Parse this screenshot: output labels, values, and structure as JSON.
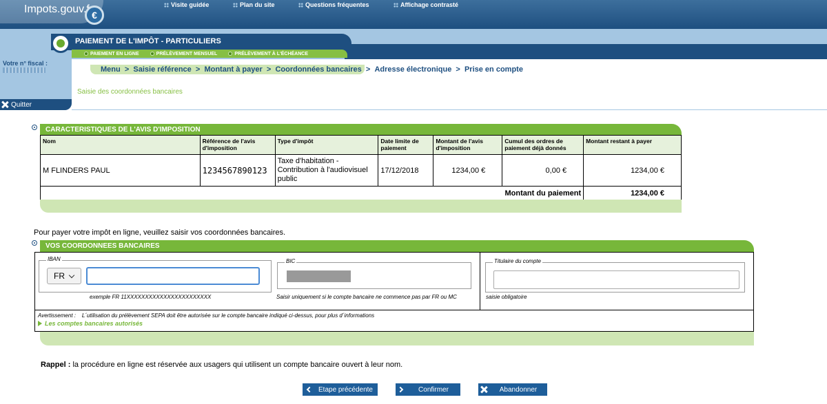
{
  "header": {
    "logo_text": "Impots.gouv.fr",
    "links": [
      "Visite guidée",
      "Plan du site",
      "Questions fréquentes",
      "Affichage contrasté"
    ]
  },
  "sidebar": {
    "fiscal_label": "Votre n° fiscal :",
    "quit_label": "Quitter"
  },
  "page": {
    "title": "PAIEMENT DE L'IMPÔT - PARTICULIERS",
    "subtabs": [
      "PAIEMENT EN LIGNE",
      "PRÉLÈVEMENT MENSUEL",
      "PRÉLÈVEMENT À L'ÉCHÉANCE"
    ],
    "breadcrumb": [
      "Menu",
      "Saisie référence",
      "Montant à payer",
      "Coordonnées bancaires",
      "Adresse électronique",
      "Prise en compte"
    ],
    "breadcrumb_sep": "  >  ",
    "subtitle": "Saisie des coordonnées bancaires"
  },
  "avis": {
    "heading": "CARACTERISTIQUES DE L'AVIS D'IMPOSITION",
    "columns": [
      "Nom",
      "Référence de l'avis d'imposition",
      "Type d'impôt",
      "Date limite de paiement",
      "Montant de l'avis d'imposition",
      "Cumul des ordres de paiement déjà donnés",
      "Montant restant à payer"
    ],
    "row": {
      "nom": "M FLINDERS PAUL",
      "reference": "1234567890123",
      "type": "Taxe d'habitation - Contribution à l'audiovisuel public",
      "date": "17/12/2018",
      "montant": "1234,00 €",
      "cumul": "0,00 €",
      "restant": "1234,00 €"
    },
    "total_label": "Montant du paiement",
    "total_value": "1234,00 €"
  },
  "instructions": "Pour payer votre impôt en ligne, veuillez saisir vos coordonnées bancaires.",
  "coords": {
    "heading": "VOS COORDONNEES BANCAIRES",
    "iban_legend": "IBAN",
    "iban_country": "FR",
    "iban_value": "",
    "iban_example": "exemple FR 11XXXXXXXXXXXXXXXXXXXXXXX",
    "bic_legend": "BIC",
    "bic_hint": "Saisir uniquement si le compte bancaire ne commence pas par FR ou MC",
    "titulaire_legend": "Titulaire du compte",
    "titulaire_value": "",
    "titulaire_hint": "saisie obligatoire",
    "warning": "Avertissement :    L´utilisation du prélèvement SEPA doit être autorisée sur le compte bancaire indiqué ci-dessus, pour plus d´informations",
    "allowed_link": "Les comptes bancaires autorisés"
  },
  "rappel": {
    "label": "Rappel :",
    "text": " la procédure en ligne est réservée aux usagers qui utilisent un compte bancaire ouvert à leur nom."
  },
  "buttons": {
    "previous": "Etape précédente",
    "confirm": "Confirmer",
    "cancel": "Abandonner"
  },
  "colors": {
    "navy": "#1e4f80",
    "light_blue": "#a4c6e2",
    "green": "#77b73a",
    "light_green": "#cfe6b4"
  }
}
